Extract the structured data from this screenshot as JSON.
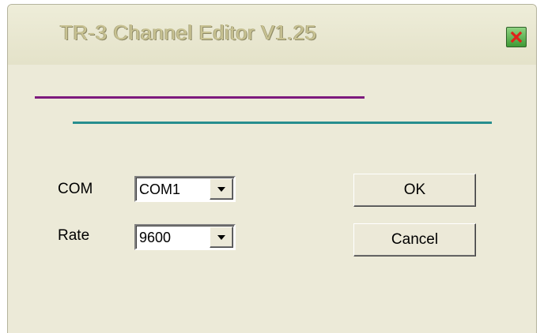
{
  "window": {
    "title": "TR-3 Channel Editor V1.25",
    "close_icon": "close-icon"
  },
  "colors": {
    "dialog_background": "#ecead8",
    "title_text": "#c8c292",
    "close_button": "#3f9a36",
    "purple_line": "#7d1a7d",
    "teal_line": "#268e8e"
  },
  "form": {
    "com": {
      "label": "COM",
      "value": "COM1"
    },
    "rate": {
      "label": "Rate",
      "value": "9600"
    }
  },
  "buttons": {
    "ok": "OK",
    "cancel": "Cancel"
  }
}
